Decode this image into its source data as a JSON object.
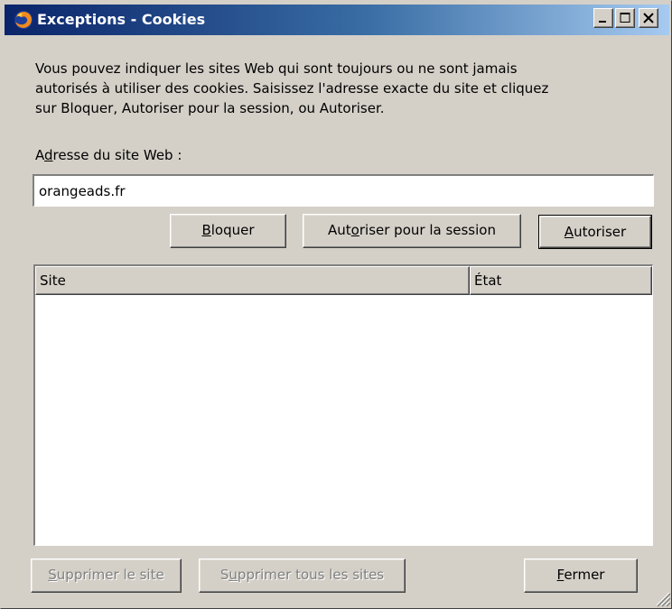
{
  "window": {
    "title": "Exceptions - Cookies",
    "title_bar_buttons": [
      "minimize-icon",
      "maximize-icon",
      "close-icon"
    ]
  },
  "description": {
    "line1": "Vous pouvez indiquer les sites Web qui sont toujours ou ne sont jamais",
    "line2": "autorisés à utiliser des cookies. Saisissez l'adresse exacte du site et cliquez",
    "line3": "sur Bloquer, Autoriser pour la session, ou Autoriser."
  },
  "address": {
    "label_pre": "A",
    "label_accel": "d",
    "label_post": "resse du site Web :",
    "value": "orangeads.fr"
  },
  "actions": {
    "block": {
      "accel": "B",
      "rest": "loquer"
    },
    "session": {
      "pre": "Aut",
      "accel": "o",
      "rest": "riser pour la session"
    },
    "allow": {
      "accel": "A",
      "rest": "utoriser"
    }
  },
  "table": {
    "columns": [
      "Site",
      "État"
    ],
    "rows": []
  },
  "footer": {
    "remove": {
      "accel": "S",
      "rest": "upprimer le site",
      "enabled": false
    },
    "remove_all": {
      "pre": "S",
      "accel": "u",
      "rest": "pprimer tous les sites",
      "enabled": false
    },
    "close": {
      "accel": "F",
      "rest": "ermer"
    }
  },
  "colors": {
    "face": "#d4d0c8",
    "title_start": "#0a246a",
    "title_end": "#a6caf0",
    "disabled_text": "#808080"
  }
}
